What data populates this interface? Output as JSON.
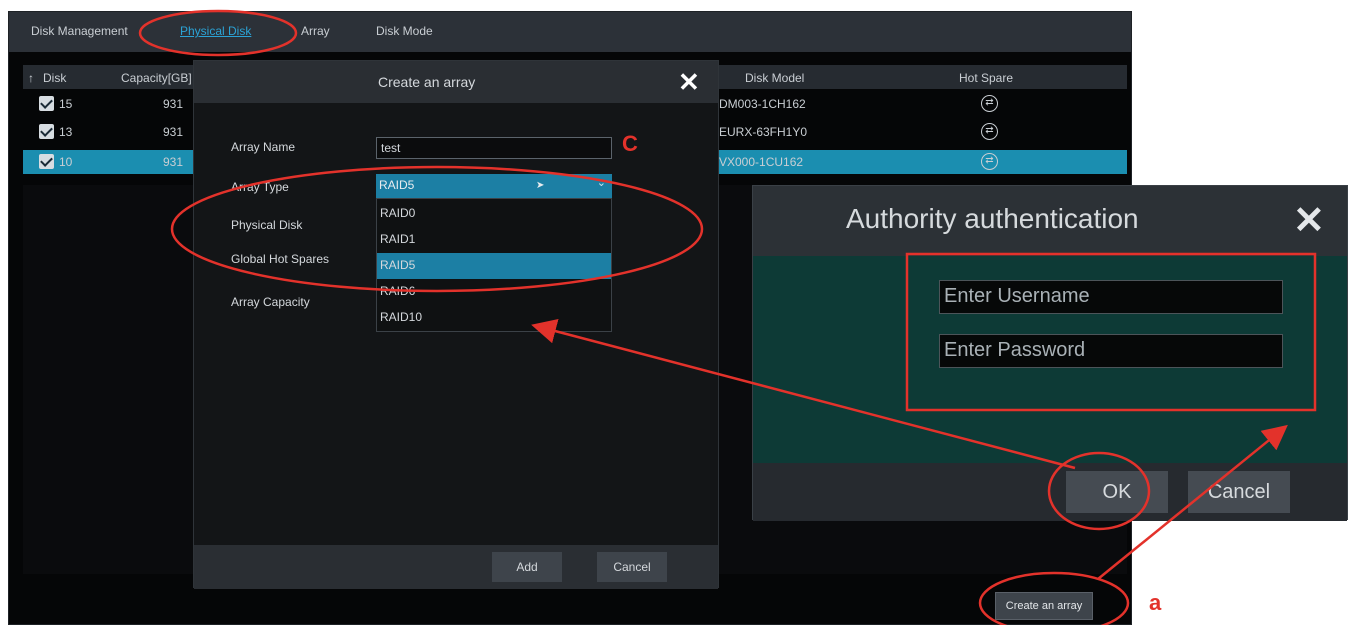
{
  "nav": {
    "items": [
      "Disk Management",
      "Physical Disk",
      "Array",
      "Disk Mode"
    ],
    "active": "Physical Disk"
  },
  "table": {
    "headers": [
      "Disk",
      "Capacity[GB]",
      "Disk Model",
      "Hot Spare"
    ],
    "rows": [
      {
        "disk": "15",
        "capacity": "931",
        "model": "DM003-1CH162",
        "checked": true,
        "selected": false
      },
      {
        "disk": "13",
        "capacity": "931",
        "model": "EURX-63FH1Y0",
        "checked": true,
        "selected": false
      },
      {
        "disk": "10",
        "capacity": "931",
        "model": "VX000-1CU162",
        "checked": true,
        "selected": true
      }
    ]
  },
  "create_button": "Create an array",
  "create_dialog": {
    "title": "Create an array",
    "labels": {
      "array_name": "Array Name",
      "array_type": "Array Type",
      "physical_disk": "Physical Disk",
      "global_hot_spares": "Global Hot Spares",
      "array_capacity": "Array Capacity"
    },
    "array_name_value": "test",
    "array_type_value": "RAID5",
    "options": [
      "RAID0",
      "RAID1",
      "RAID5",
      "RAID6",
      "RAID10"
    ],
    "selected_option": "RAID5",
    "add_button": "Add",
    "cancel_button": "Cancel"
  },
  "auth_dialog": {
    "title": "Authority authentication",
    "username_placeholder": "Enter Username",
    "password_placeholder": "Enter Password",
    "ok_button": "OK",
    "cancel_button": "Cancel"
  },
  "annotations": {
    "c": "C",
    "a": "a"
  },
  "colors": {
    "accent": "#1c7fa4",
    "annotation": "#e3322b",
    "auth_body": "#0d3a36"
  },
  "icons": [
    "close-icon",
    "sort-arrow-icon",
    "checkbox-icon",
    "hot-spare-icon",
    "chevron-down-icon"
  ]
}
